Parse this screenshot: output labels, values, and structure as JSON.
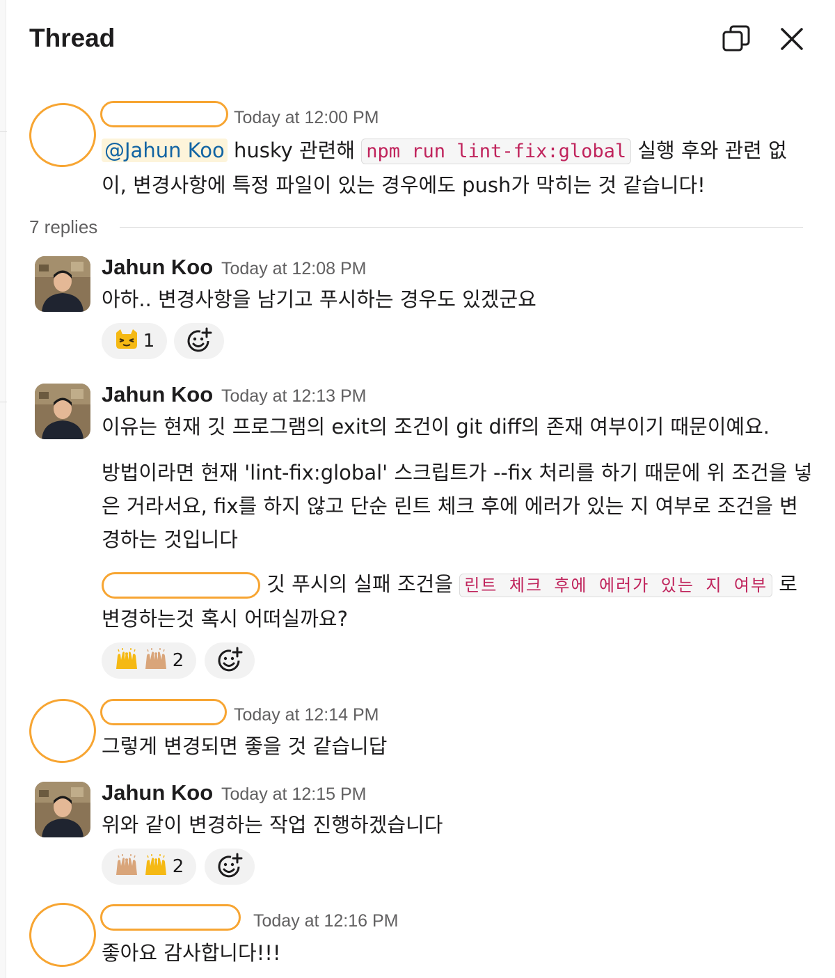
{
  "header": {
    "title": "Thread",
    "icons": [
      "open-in-window-icon",
      "close-icon"
    ]
  },
  "colors": {
    "redaction": "#f7a532",
    "mention_bg": "#fdf4da",
    "mention_text": "#1264a3",
    "code_text": "#c0245c",
    "reaction_bg": "#f2f2f2"
  },
  "parent": {
    "time": "Today at 12:00 PM",
    "mention": "@Jahun Koo",
    "text_a": " husky 관련해 ",
    "code": "npm run lint-fix:global",
    "text_b": " 실행 후와 관련 없",
    "text_c": "이, 변경사항에 특정 파일이 있는 경우에도 push가 막히는 것 같습니다!"
  },
  "thread": {
    "replies_label": "7 replies"
  },
  "replies": [
    {
      "name": "Jahun Koo",
      "time": "Today at 12:08 PM",
      "text": "아하.. 변경사항을 남기고 푸시하는 경우도 있겠군요",
      "reaction": {
        "emoji": "cat-laughing-emoji",
        "count": "1"
      }
    },
    {
      "name": "Jahun Koo",
      "time": "Today at 12:13 PM",
      "p1": "이유는 현재 깃 프로그램의 exit의 조건이 git diff의 존재 여부이기 때문이예요.",
      "p2": "방법이라면 현재 'lint-fix:global' 스크립트가 --fix 처리를 하기 때문에 위 조건을 넣은 거라서요, fix를 하지 않고 단순 린트 체크 후에 에러가 있는 지 여부로 조건을 변경하는 것입니다",
      "p3_a": " 깃 푸시의 실패 조건을 ",
      "p3_code": "린트 체크 후에 에러가 있는 지 여부",
      "p3_b": " 로",
      "p3_c": "변경하는것 혹시 어떠실까요?",
      "reaction": {
        "emoji": "raised-hands-emoji",
        "count": "2"
      }
    },
    {
      "time": "Today at 12:14 PM",
      "text": "그렇게 변경되면 좋을 것 같습니답"
    },
    {
      "name": "Jahun Koo",
      "time": "Today at 12:15 PM",
      "text": "위와 같이 변경하는 작업 진행하겠습니다",
      "reaction": {
        "emoji": "raised-hands-emoji",
        "count": "2"
      }
    },
    {
      "time": "Today at 12:16 PM",
      "text": "좋아요 감사합니다!!!"
    }
  ]
}
